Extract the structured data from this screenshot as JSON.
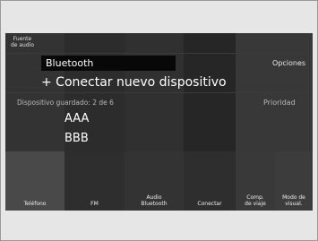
{
  "source": {
    "label_line1": "Fuente",
    "label_line2": "de audio"
  },
  "header": {
    "title": "Bluetooth",
    "options_label": "Opciones"
  },
  "actions": {
    "add_device": "+ Conectar nuevo dispositivo"
  },
  "saved": {
    "info": "Dispositivo guardado: 2 de 6",
    "priority_label": "Prioridad"
  },
  "devices": [
    {
      "name": "AAA"
    },
    {
      "name": "BBB"
    }
  ],
  "tabs": [
    {
      "line1": "Teléfono",
      "line2": ""
    },
    {
      "line1": "FM",
      "line2": ""
    },
    {
      "line1": "Audio",
      "line2": "Bluetooth"
    },
    {
      "line1": "Conectar",
      "line2": ""
    },
    {
      "line1": "Comp.",
      "line2": "de viaje"
    },
    {
      "line1": "Modo de",
      "line2": "visual."
    }
  ],
  "colors": {
    "screen_bg": "#2b2b2b",
    "title_box_bg": "#080808",
    "selected_tab_bg": "#494949",
    "page_bg": "#e6e6e6"
  }
}
